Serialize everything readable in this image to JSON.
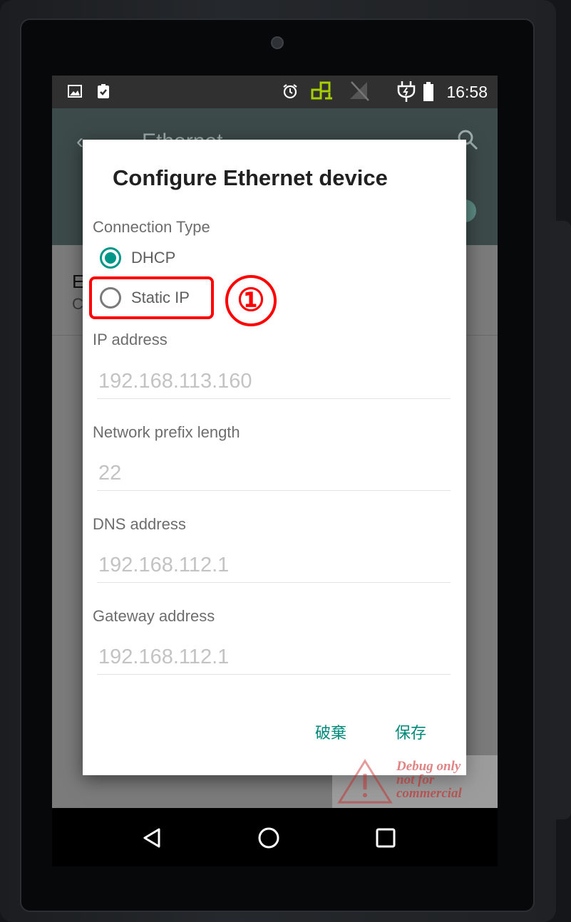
{
  "status_bar": {
    "time": "16:58",
    "left_icons": [
      "image-icon",
      "clipboard-check-icon"
    ],
    "right_icons": [
      "alarm-icon",
      "ethernet-icon",
      "no-signal-icon",
      "plug-icon",
      "battery-icon"
    ]
  },
  "app_bar": {
    "title": "Ethernet",
    "back_icon": "back-arrow-icon",
    "search_icon": "search-icon"
  },
  "background_row": {
    "title_partial": "E",
    "subtitle_partial": "C"
  },
  "dialog": {
    "title": "Configure Ethernet device",
    "connection_type_label": "Connection Type",
    "options": [
      {
        "label": "DHCP",
        "selected": true
      },
      {
        "label": "Static IP",
        "selected": false
      }
    ],
    "fields": [
      {
        "label": "IP address",
        "placeholder": "192.168.113.160"
      },
      {
        "label": "Network prefix length",
        "placeholder": "22"
      },
      {
        "label": "DNS address",
        "placeholder": "192.168.112.1"
      },
      {
        "label": "Gateway address",
        "placeholder": "192.168.112.1"
      }
    ],
    "buttons": {
      "discard": "破棄",
      "save": "保存"
    }
  },
  "annotation": {
    "step": "①"
  },
  "watermark": {
    "line1": "Debug only",
    "line2": "not for",
    "line3": "commercial"
  },
  "colors": {
    "accent": "#009688",
    "highlight": "#ff0000"
  }
}
